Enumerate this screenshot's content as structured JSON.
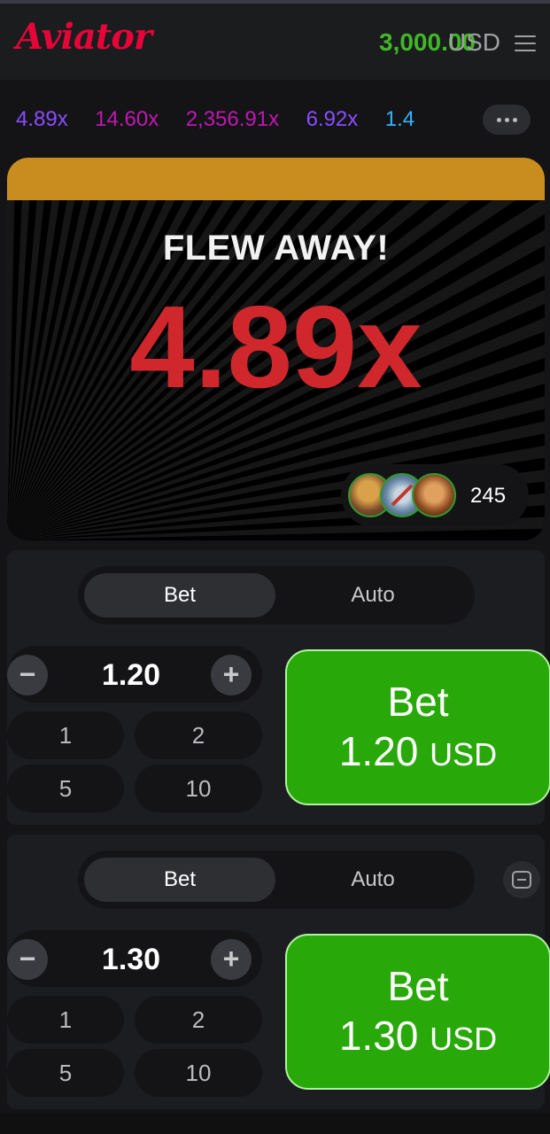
{
  "header": {
    "logo": "Aviator",
    "balance": "3,000.00",
    "currency": "USD"
  },
  "history": {
    "multipliers": [
      {
        "value": "4.89x",
        "color": "#8a4cff"
      },
      {
        "value": "14.60x",
        "color": "#c017b4"
      },
      {
        "value": "2,356.91x",
        "color": "#c017b4"
      },
      {
        "value": "6.92x",
        "color": "#8a4cff"
      },
      {
        "value": "1.4",
        "color": "#34b4ff"
      }
    ]
  },
  "game": {
    "status": "FLEW AWAY!",
    "multiplier": "4.89x",
    "player_count": "245"
  },
  "panels": [
    {
      "tabs": {
        "bet": "Bet",
        "auto": "Auto"
      },
      "amount": "1.20",
      "quick": [
        "1",
        "2",
        "5",
        "10"
      ],
      "bet_button": {
        "label": "Bet",
        "amount": "1.20",
        "currency": "USD"
      }
    },
    {
      "tabs": {
        "bet": "Bet",
        "auto": "Auto"
      },
      "amount": "1.30",
      "quick": [
        "1",
        "2",
        "5",
        "10"
      ],
      "bet_button": {
        "label": "Bet",
        "amount": "1.30",
        "currency": "USD"
      }
    }
  ],
  "colors": {
    "brand_red": "#e50539",
    "balance_green": "#3fb826",
    "bet_green": "#28a909",
    "crash_red": "#d0272d",
    "game_top": "#c98d1f"
  }
}
